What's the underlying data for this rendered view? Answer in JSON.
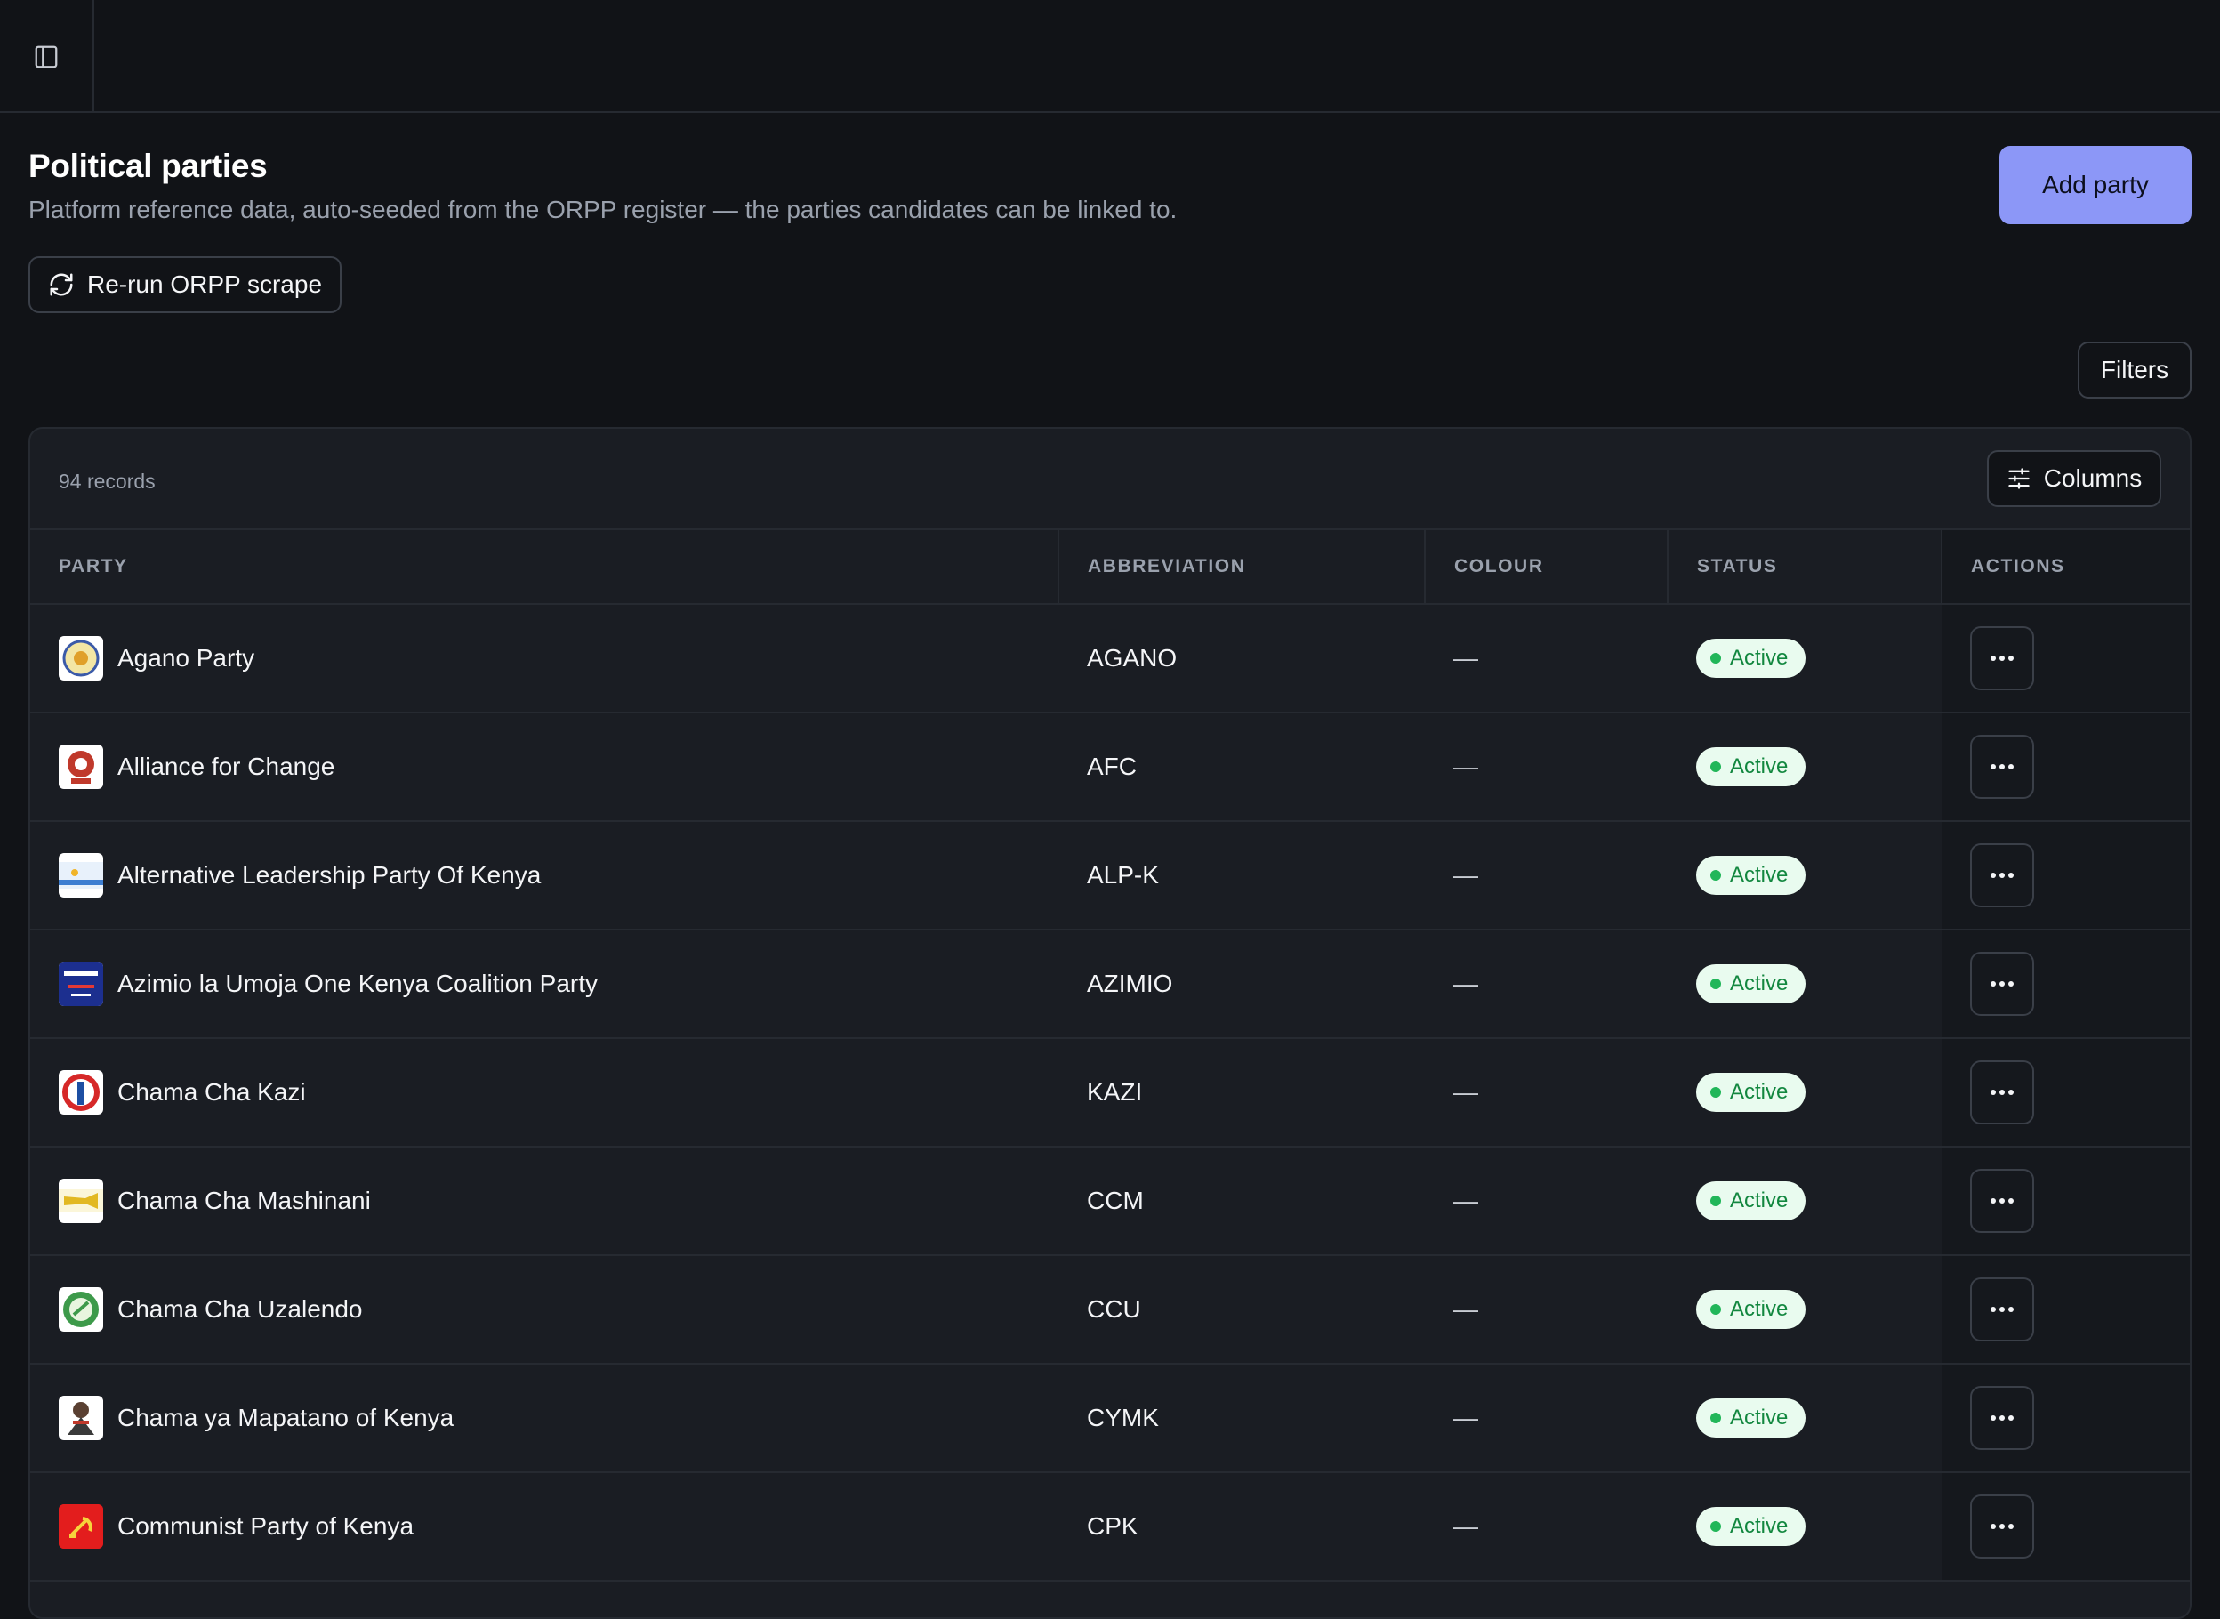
{
  "page": {
    "title": "Political parties",
    "subtitle": "Platform reference data, auto-seeded from the ORPP register — the parties candidates can be linked to.",
    "add_label": "Add party",
    "rerun_label": "Re-run ORPP scrape",
    "filters_label": "Filters"
  },
  "table": {
    "records_label": "94 records",
    "columns_label": "Columns",
    "headers": [
      "PARTY",
      "ABBREVIATION",
      "COLOUR",
      "STATUS",
      "ACTIONS"
    ],
    "rows": [
      {
        "name": "Agano Party",
        "abbr": "AGANO",
        "colour": "—",
        "status": "Active"
      },
      {
        "name": "Alliance for Change",
        "abbr": "AFC",
        "colour": "—",
        "status": "Active"
      },
      {
        "name": "Alternative Leadership Party Of Kenya",
        "abbr": "ALP-K",
        "colour": "—",
        "status": "Active"
      },
      {
        "name": "Azimio la Umoja One Kenya Coalition Party",
        "abbr": "AZIMIO",
        "colour": "—",
        "status": "Active"
      },
      {
        "name": "Chama Cha Kazi",
        "abbr": "KAZI",
        "colour": "—",
        "status": "Active"
      },
      {
        "name": "Chama Cha Mashinani",
        "abbr": "CCM",
        "colour": "—",
        "status": "Active"
      },
      {
        "name": "Chama Cha Uzalendo",
        "abbr": "CCU",
        "colour": "—",
        "status": "Active"
      },
      {
        "name": "Chama ya Mapatano of Kenya",
        "abbr": "CYMK",
        "colour": "—",
        "status": "Active"
      },
      {
        "name": "Communist Party of Kenya",
        "abbr": "CPK",
        "colour": "—",
        "status": "Active"
      }
    ]
  },
  "icons": {
    "sidebar": "panel-left-icon",
    "rerun": "refresh-icon",
    "columns": "sliders-icon",
    "more": "more-horizontal-icon"
  },
  "colors": {
    "accent": "#8c97f7",
    "status_bg": "#e9fbef",
    "status_text": "#12873f",
    "status_dot": "#21b659"
  }
}
